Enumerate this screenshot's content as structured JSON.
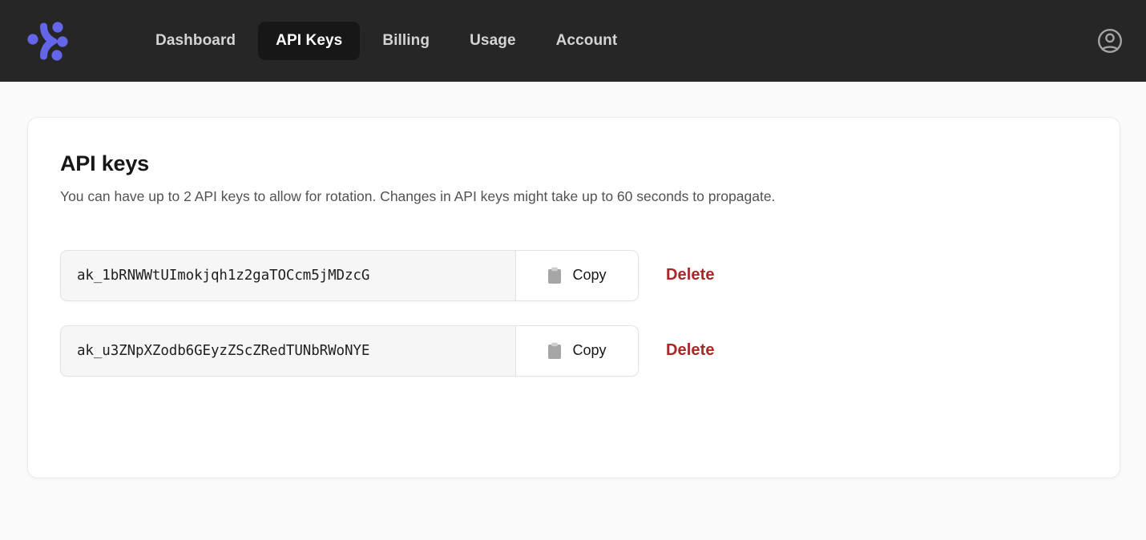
{
  "nav": {
    "logo_name": "brand-logo",
    "logo_color": "#6366e8",
    "items": [
      {
        "label": "Dashboard",
        "active": false
      },
      {
        "label": "API Keys",
        "active": true
      },
      {
        "label": "Billing",
        "active": false
      },
      {
        "label": "Usage",
        "active": false
      },
      {
        "label": "Account",
        "active": false
      }
    ],
    "account_icon": "user-circle-icon",
    "background": "#262626",
    "active_pill_background": "#171717"
  },
  "card": {
    "title": "API keys",
    "description": "You can have up to 2 API keys to allow for rotation. Changes in API keys might take up to 60 seconds to propagate.",
    "max_keys": 2,
    "propagation_seconds": 60,
    "copy_label": "Copy",
    "copy_icon": "clipboard-icon",
    "delete_label": "Delete",
    "delete_color": "#ab2626",
    "key_placeholder": "API key",
    "keys": [
      {
        "value": "ak_1bRNWWtUImokjqh1z2gaTOCcm5jMDzcG"
      },
      {
        "value": "ak_u3ZNpXZodb6GEyzZScZRedTUNbRWoNYE"
      }
    ]
  }
}
